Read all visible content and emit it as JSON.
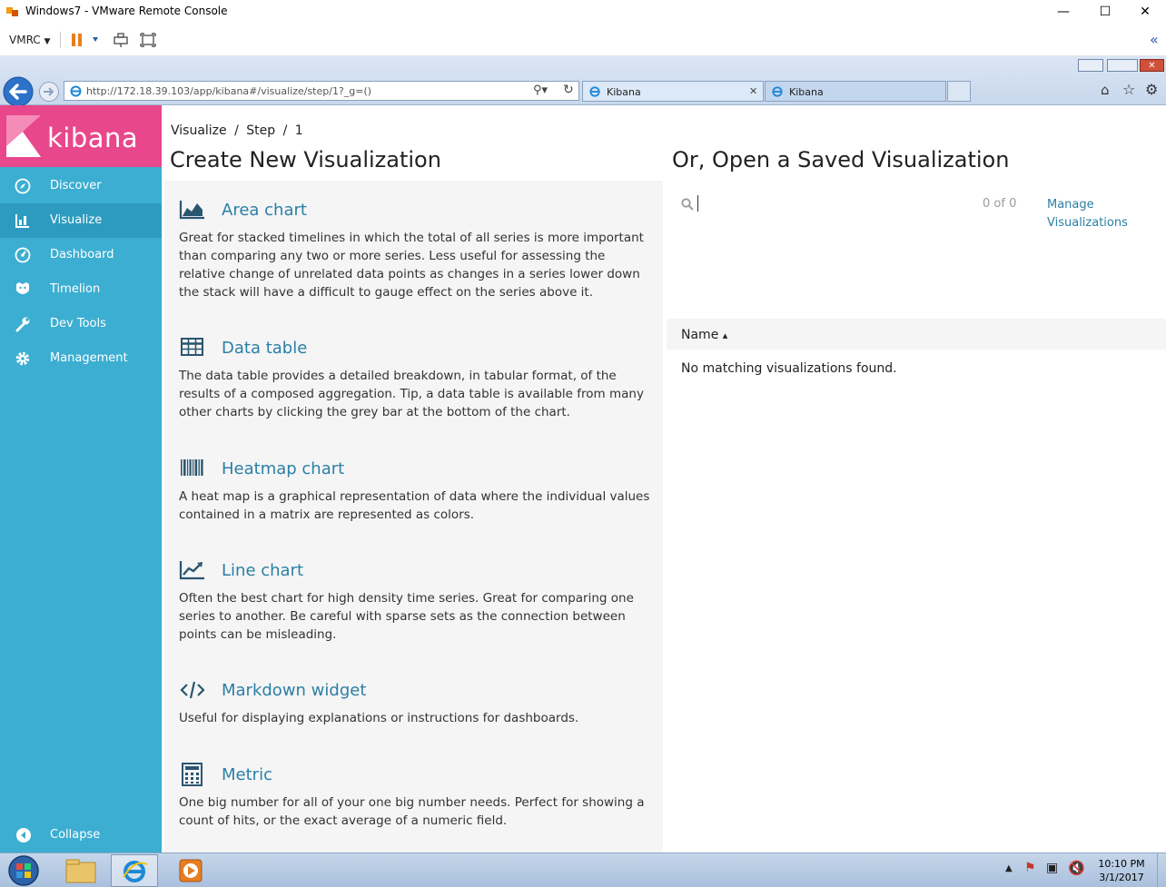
{
  "window": {
    "title": "Windows7 - VMware Remote Console",
    "minimize": "—",
    "maximize": "☐",
    "close": "✕"
  },
  "vmrc_toolbar": {
    "label": "VMRC"
  },
  "browser": {
    "address": "http://172.18.39.103/app/kibana#/visualize/step/1?_g=()",
    "tabs": [
      {
        "label": "Kibana"
      },
      {
        "label": "Kibana"
      }
    ]
  },
  "sidebar": {
    "logo_text": "kibana",
    "items": [
      {
        "label": "Discover",
        "icon": "compass-icon"
      },
      {
        "label": "Visualize",
        "icon": "bar-chart-icon"
      },
      {
        "label": "Dashboard",
        "icon": "dashboard-icon"
      },
      {
        "label": "Timelion",
        "icon": "timelion-icon"
      },
      {
        "label": "Dev Tools",
        "icon": "wrench-icon"
      },
      {
        "label": "Management",
        "icon": "gear-icon"
      }
    ],
    "collapse_label": "Collapse"
  },
  "breadcrumb": [
    "Visualize",
    "/",
    "Step",
    "/",
    "1"
  ],
  "create": {
    "title": "Create New Visualization",
    "items": [
      {
        "title": "Area chart",
        "icon": "area-chart-icon",
        "desc": "Great for stacked timelines in which the total of all series is more important than comparing any two or more series. Less useful for assessing the relative change of unrelated data points as changes in a series lower down the stack will have a difficult to gauge effect on the series above it."
      },
      {
        "title": "Data table",
        "icon": "table-icon",
        "desc": "The data table provides a detailed breakdown, in tabular format, of the results of a composed aggregation. Tip, a data table is available from many other charts by clicking the grey bar at the bottom of the chart."
      },
      {
        "title": "Heatmap chart",
        "icon": "barcode-icon",
        "desc": "A heat map is a graphical representation of data where the individual values contained in a matrix are represented as colors."
      },
      {
        "title": "Line chart",
        "icon": "line-chart-icon",
        "desc": "Often the best chart for high density time series. Great for comparing one series to another. Be careful with sparse sets as the connection between points can be misleading."
      },
      {
        "title": "Markdown widget",
        "icon": "code-icon",
        "desc": "Useful for displaying explanations or instructions for dashboards."
      },
      {
        "title": "Metric",
        "icon": "calculator-icon",
        "desc": "One big number for all of your one big number needs. Perfect for showing a count of hits, or the exact average of a numeric field."
      }
    ]
  },
  "saved": {
    "title": "Or, Open a Saved Visualization",
    "count": "0 of 0",
    "manage_label": "Manage Visualizations",
    "column_name": "Name",
    "sort_glyph": "▴",
    "empty_text": "No matching visualizations found."
  },
  "taskbar": {
    "time": "10:10 PM",
    "date": "3/1/2017"
  },
  "colors": {
    "sidebar": "#3caed2",
    "logo": "#e8478b",
    "link": "#2a7fa6"
  }
}
